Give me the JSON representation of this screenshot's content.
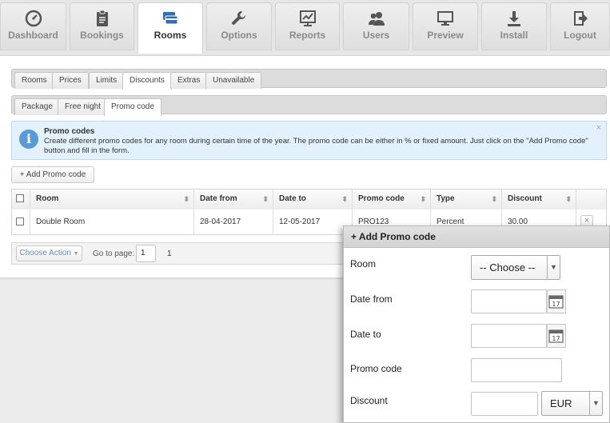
{
  "nav": {
    "tabs": [
      {
        "label": "Dashboard",
        "icon": "dashboard-icon"
      },
      {
        "label": "Bookings",
        "icon": "clipboard-icon"
      },
      {
        "label": "Rooms",
        "icon": "credit-card-icon"
      },
      {
        "label": "Options",
        "icon": "wrench-icon"
      },
      {
        "label": "Reports",
        "icon": "chart-icon"
      },
      {
        "label": "Users",
        "icon": "users-icon"
      },
      {
        "label": "Preview",
        "icon": "monitor-icon"
      },
      {
        "label": "Install",
        "icon": "download-icon"
      },
      {
        "label": "Logout",
        "icon": "logout-icon"
      }
    ],
    "active": "Rooms"
  },
  "subtabs": [
    "Rooms",
    "Prices",
    "Limits",
    "Discounts",
    "Extras",
    "Unavailable"
  ],
  "discount_tabs": [
    "Package",
    "Free night",
    "Promo code"
  ],
  "info": {
    "title": "Promo codes",
    "text": "Create different promo codes for any room during certain time of the year. The promo code can be either in % or fixed amount. Just click on the \"Add Promo code\" button and fill in the form.",
    "close": "×"
  },
  "add_button": "+ Add Promo code",
  "table": {
    "columns": [
      "Room",
      "Date from",
      "Date to",
      "Promo code",
      "Type",
      "Discount"
    ],
    "rows": [
      {
        "room": "Double Room",
        "date_from": "28-04-2017",
        "date_to": "12-05-2017",
        "promo_code": "PRO123",
        "type": "Percent",
        "discount": "30.00"
      }
    ],
    "delete_icon": "×"
  },
  "pager": {
    "choose_action": "Choose Action",
    "goto_label": "Go to page:",
    "page_value": "1",
    "page_num": "1"
  },
  "modal": {
    "title": "+ Add Promo code",
    "room_label": "Room",
    "room_select": "-- Choose --",
    "date_from_label": "Date from",
    "date_to_label": "Date to",
    "promo_code_label": "Promo code",
    "discount_label": "Discount",
    "currency": "EUR"
  }
}
